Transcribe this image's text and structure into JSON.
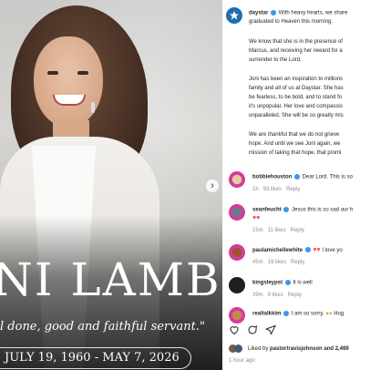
{
  "photo": {
    "name": "NI LAMB",
    "quote": "l done, good and faithful servant.\"",
    "dates": "JULY 19, 1960 - MAY 7, 2026"
  },
  "post": {
    "account": "daystar",
    "caption_lines": [
      "With heavy hearts, we share",
      "graduated to Heaven this morning.",
      "",
      "We know that she is in the presence of",
      "Marcus, and receiving her reward for a",
      "surrender to the Lord.",
      "",
      "Joni has been an inspiration to millions",
      "family and all of us at Daystar. She has",
      "be fearless, to be bold, and to stand fo",
      "it's unpopular. Her love and compassio",
      "unparalleled. She will be so greatly mis",
      "",
      "We are thankful that we do not grieve",
      "hope. And until we see Joni again, we",
      "mission of taking that hope, that promi"
    ]
  },
  "comments": [
    {
      "user": "bobbiehouston",
      "text": "Dear Lord. This is so",
      "time": "1h",
      "likes": "93 likes",
      "reply": "Reply"
    },
    {
      "user": "seanfeucht",
      "text": "Jesus this is so sad our h",
      "time": "15m",
      "likes": "11 likes",
      "reply": "Reply"
    },
    {
      "user": "paulamichellewhite",
      "text": "I love yo",
      "time": "45m",
      "likes": "19 likes",
      "reply": "Reply"
    },
    {
      "user": "kingsleypst",
      "text": "It is well",
      "time": "39m",
      "likes": "8 likes",
      "reply": "Reply"
    },
    {
      "user": "realtalkkim",
      "text": "I am so sorry.",
      "suffix": "Hug"
    }
  ],
  "footer": {
    "liked_by": "Liked by",
    "liked_user": "pastortravisjohnson",
    "liked_rest": "and 2,469",
    "time_ago": "1 hour ago"
  },
  "colors": {
    "accent": "#3897f0",
    "heart": "#ed4956"
  }
}
